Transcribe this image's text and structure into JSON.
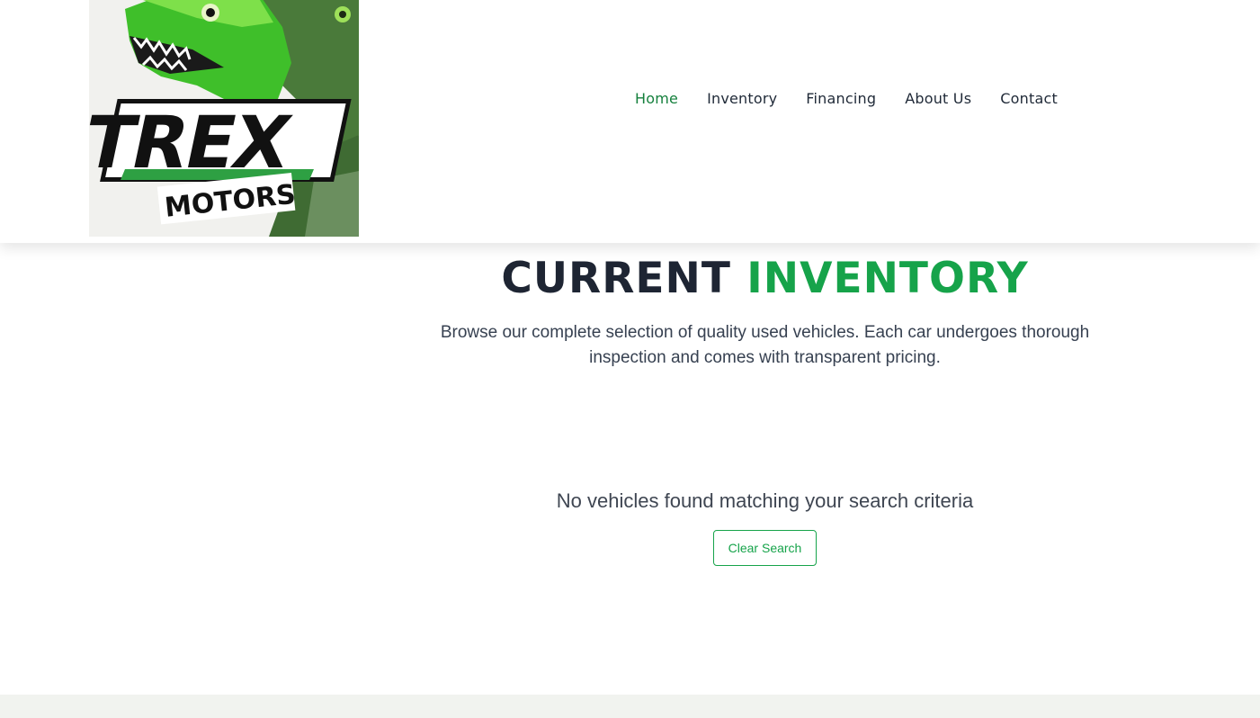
{
  "brand": {
    "logo_word": "TREX",
    "logo_sub": "MOTORS",
    "accent_color": "#16a34a",
    "dark_color": "#1e2533"
  },
  "nav": {
    "items": [
      {
        "label": "Home",
        "active": true
      },
      {
        "label": "Inventory",
        "active": false
      },
      {
        "label": "Financing",
        "active": false
      },
      {
        "label": "About Us",
        "active": false
      },
      {
        "label": "Contact",
        "active": false
      }
    ]
  },
  "hero": {
    "title_main": "CURRENT",
    "title_accent": "INVENTORY",
    "subtitle": "Browse our complete selection of quality used vehicles. Each car undergoes thorough inspection and comes with transparent pricing."
  },
  "empty_state": {
    "message": "No vehicles found matching your search criteria",
    "clear_button": "Clear Search"
  }
}
